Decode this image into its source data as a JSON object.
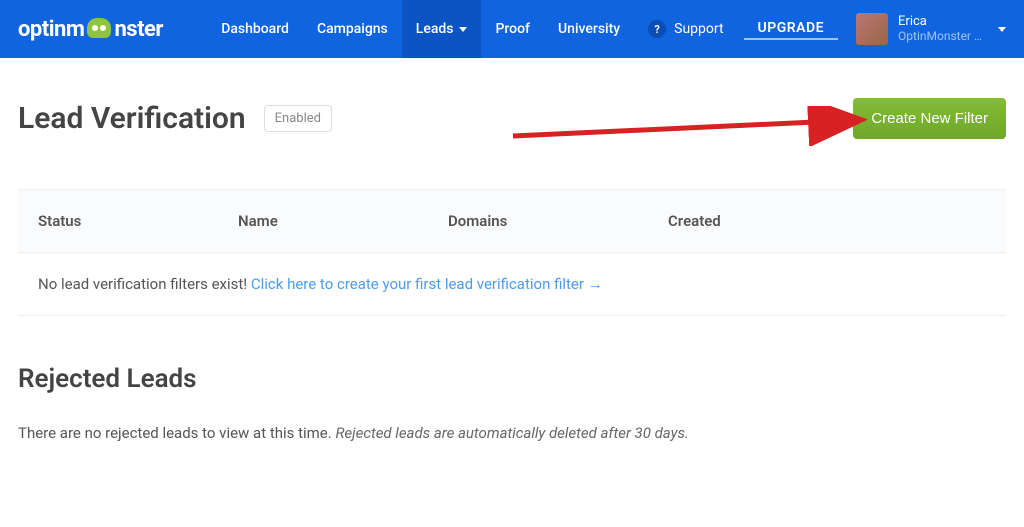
{
  "brand": {
    "name_part1": "optinm",
    "name_part2": "nster"
  },
  "nav": {
    "dashboard": "Dashboard",
    "campaigns": "Campaigns",
    "leads": "Leads",
    "proof": "Proof",
    "university": "University",
    "support": "Support",
    "upgrade": "UPGRADE"
  },
  "user": {
    "name": "Erica",
    "org": "OptinMonster …"
  },
  "page": {
    "title": "Lead Verification",
    "status_badge": "Enabled",
    "create_button": "Create New Filter"
  },
  "table": {
    "columns": {
      "status": "Status",
      "name": "Name",
      "domains": "Domains",
      "created": "Created"
    },
    "empty_prefix": "No lead verification filters exist! ",
    "empty_link": "Click here to create your first lead verification filter →"
  },
  "rejected": {
    "title": "Rejected Leads",
    "text": "There are no rejected leads to view at this time. ",
    "note": "Rejected leads are automatically deleted after 30 days."
  }
}
